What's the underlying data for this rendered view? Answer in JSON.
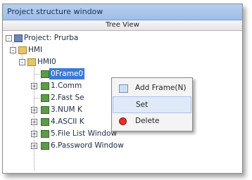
{
  "window": {
    "title": "Project structure window"
  },
  "tree": {
    "header": "Tree View",
    "items": [
      {
        "label": "Project: Prurba",
        "expander": "-"
      },
      {
        "label": "HMI",
        "expander": "-"
      },
      {
        "label": "HMI0",
        "expander": "-"
      },
      {
        "label": "0Frame0",
        "selected": true
      },
      {
        "label": "1.Comm",
        "expander": "+"
      },
      {
        "label": "2.Fast Se"
      },
      {
        "label": "3.NUM K",
        "expander": "+"
      },
      {
        "label": "4.ASCII K",
        "expander": "+"
      },
      {
        "label": "5.File List Window",
        "expander": "+"
      },
      {
        "label": "6.Password Window",
        "expander": "+"
      }
    ]
  },
  "context_menu": {
    "items": [
      {
        "label": "Add Frame(N)",
        "icon": "add-frame-icon"
      },
      {
        "label": "Set",
        "highlight": true
      },
      {
        "label": "Delete",
        "icon": "delete-icon"
      }
    ]
  },
  "colors": {
    "title_bar": "#a9c6ee",
    "selection": "#3d7ad6",
    "menu_highlight": "#dfe9f7",
    "delete_icon": "#e0312c"
  }
}
